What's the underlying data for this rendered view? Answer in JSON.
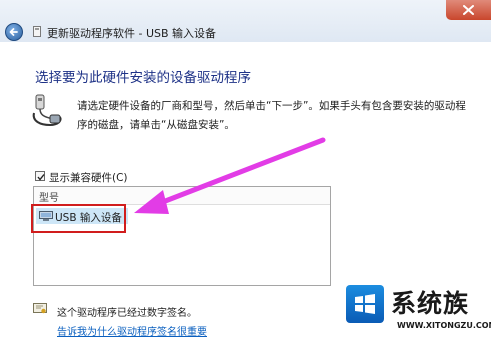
{
  "window": {
    "title": "更新驱动程序软件 - USB 输入设备",
    "back_icon": "back-arrow-icon",
    "close_icon": "close-icon"
  },
  "content": {
    "heading": "选择要为此硬件安装的设备驱动程序",
    "description": "请选定硬件设备的厂商和型号，然后单击“下一步”。如果手头有包含要安装的驱动程序的磁盘，请单击“从磁盘安装”。",
    "show_compatible_label": "显示兼容硬件(C)",
    "show_compatible_checked": true
  },
  "model_list": {
    "header": "型号",
    "items": [
      {
        "label": "USB 输入设备",
        "icon": "input-device-icon",
        "selected": true
      }
    ]
  },
  "footer": {
    "signed_text": "这个驱动程序已经过数字签名。",
    "link_text": "告诉我为什么驱动程序签名很重要"
  },
  "watermark": {
    "text": "系统族",
    "url": "WWW.XITONGZU.COM"
  },
  "annotation": {
    "arrow_color": "#e23ce6",
    "box_color": "#d11d1d"
  }
}
